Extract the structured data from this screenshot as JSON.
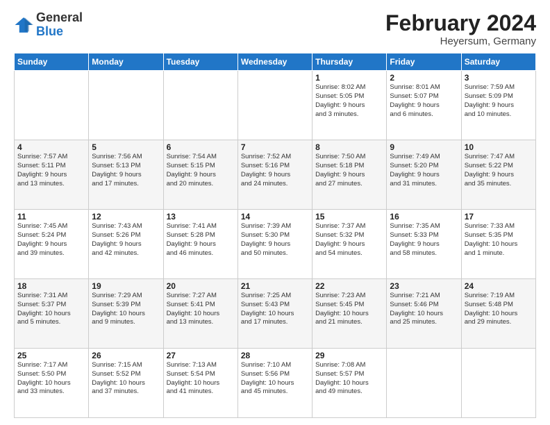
{
  "header": {
    "logo": {
      "general": "General",
      "blue": "Blue"
    },
    "title": "February 2024",
    "subtitle": "Heyersum, Germany"
  },
  "weekdays": [
    "Sunday",
    "Monday",
    "Tuesday",
    "Wednesday",
    "Thursday",
    "Friday",
    "Saturday"
  ],
  "weeks": [
    [
      {
        "day": "",
        "info": ""
      },
      {
        "day": "",
        "info": ""
      },
      {
        "day": "",
        "info": ""
      },
      {
        "day": "",
        "info": ""
      },
      {
        "day": "1",
        "info": "Sunrise: 8:02 AM\nSunset: 5:05 PM\nDaylight: 9 hours\nand 3 minutes."
      },
      {
        "day": "2",
        "info": "Sunrise: 8:01 AM\nSunset: 5:07 PM\nDaylight: 9 hours\nand 6 minutes."
      },
      {
        "day": "3",
        "info": "Sunrise: 7:59 AM\nSunset: 5:09 PM\nDaylight: 9 hours\nand 10 minutes."
      }
    ],
    [
      {
        "day": "4",
        "info": "Sunrise: 7:57 AM\nSunset: 5:11 PM\nDaylight: 9 hours\nand 13 minutes."
      },
      {
        "day": "5",
        "info": "Sunrise: 7:56 AM\nSunset: 5:13 PM\nDaylight: 9 hours\nand 17 minutes."
      },
      {
        "day": "6",
        "info": "Sunrise: 7:54 AM\nSunset: 5:15 PM\nDaylight: 9 hours\nand 20 minutes."
      },
      {
        "day": "7",
        "info": "Sunrise: 7:52 AM\nSunset: 5:16 PM\nDaylight: 9 hours\nand 24 minutes."
      },
      {
        "day": "8",
        "info": "Sunrise: 7:50 AM\nSunset: 5:18 PM\nDaylight: 9 hours\nand 27 minutes."
      },
      {
        "day": "9",
        "info": "Sunrise: 7:49 AM\nSunset: 5:20 PM\nDaylight: 9 hours\nand 31 minutes."
      },
      {
        "day": "10",
        "info": "Sunrise: 7:47 AM\nSunset: 5:22 PM\nDaylight: 9 hours\nand 35 minutes."
      }
    ],
    [
      {
        "day": "11",
        "info": "Sunrise: 7:45 AM\nSunset: 5:24 PM\nDaylight: 9 hours\nand 39 minutes."
      },
      {
        "day": "12",
        "info": "Sunrise: 7:43 AM\nSunset: 5:26 PM\nDaylight: 9 hours\nand 42 minutes."
      },
      {
        "day": "13",
        "info": "Sunrise: 7:41 AM\nSunset: 5:28 PM\nDaylight: 9 hours\nand 46 minutes."
      },
      {
        "day": "14",
        "info": "Sunrise: 7:39 AM\nSunset: 5:30 PM\nDaylight: 9 hours\nand 50 minutes."
      },
      {
        "day": "15",
        "info": "Sunrise: 7:37 AM\nSunset: 5:32 PM\nDaylight: 9 hours\nand 54 minutes."
      },
      {
        "day": "16",
        "info": "Sunrise: 7:35 AM\nSunset: 5:33 PM\nDaylight: 9 hours\nand 58 minutes."
      },
      {
        "day": "17",
        "info": "Sunrise: 7:33 AM\nSunset: 5:35 PM\nDaylight: 10 hours\nand 1 minute."
      }
    ],
    [
      {
        "day": "18",
        "info": "Sunrise: 7:31 AM\nSunset: 5:37 PM\nDaylight: 10 hours\nand 5 minutes."
      },
      {
        "day": "19",
        "info": "Sunrise: 7:29 AM\nSunset: 5:39 PM\nDaylight: 10 hours\nand 9 minutes."
      },
      {
        "day": "20",
        "info": "Sunrise: 7:27 AM\nSunset: 5:41 PM\nDaylight: 10 hours\nand 13 minutes."
      },
      {
        "day": "21",
        "info": "Sunrise: 7:25 AM\nSunset: 5:43 PM\nDaylight: 10 hours\nand 17 minutes."
      },
      {
        "day": "22",
        "info": "Sunrise: 7:23 AM\nSunset: 5:45 PM\nDaylight: 10 hours\nand 21 minutes."
      },
      {
        "day": "23",
        "info": "Sunrise: 7:21 AM\nSunset: 5:46 PM\nDaylight: 10 hours\nand 25 minutes."
      },
      {
        "day": "24",
        "info": "Sunrise: 7:19 AM\nSunset: 5:48 PM\nDaylight: 10 hours\nand 29 minutes."
      }
    ],
    [
      {
        "day": "25",
        "info": "Sunrise: 7:17 AM\nSunset: 5:50 PM\nDaylight: 10 hours\nand 33 minutes."
      },
      {
        "day": "26",
        "info": "Sunrise: 7:15 AM\nSunset: 5:52 PM\nDaylight: 10 hours\nand 37 minutes."
      },
      {
        "day": "27",
        "info": "Sunrise: 7:13 AM\nSunset: 5:54 PM\nDaylight: 10 hours\nand 41 minutes."
      },
      {
        "day": "28",
        "info": "Sunrise: 7:10 AM\nSunset: 5:56 PM\nDaylight: 10 hours\nand 45 minutes."
      },
      {
        "day": "29",
        "info": "Sunrise: 7:08 AM\nSunset: 5:57 PM\nDaylight: 10 hours\nand 49 minutes."
      },
      {
        "day": "",
        "info": ""
      },
      {
        "day": "",
        "info": ""
      }
    ]
  ]
}
